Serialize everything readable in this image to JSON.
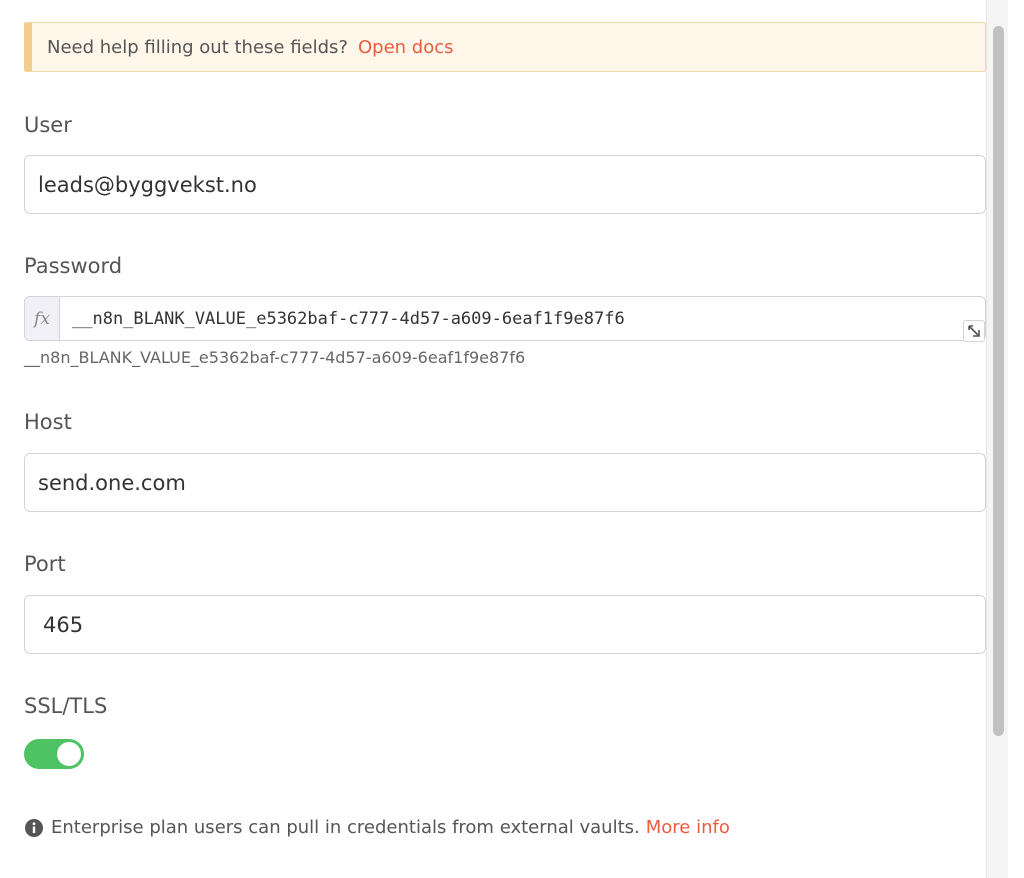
{
  "notice": {
    "text": "Need help filling out these fields?",
    "link": "Open docs"
  },
  "fields": {
    "user": {
      "label": "User",
      "value": "leads@byggvekst.no"
    },
    "password": {
      "label": "Password",
      "fx_label": "fx",
      "value": "__n8n_BLANK_VALUE_e5362baf-c777-4d57-a609-6eaf1f9e87f6",
      "hint": "__n8n_BLANK_VALUE_e5362baf-c777-4d57-a609-6eaf1f9e87f6"
    },
    "host": {
      "label": "Host",
      "value": "send.one.com"
    },
    "port": {
      "label": "Port",
      "value": "465"
    },
    "ssl": {
      "label": "SSL/TLS",
      "enabled": true
    }
  },
  "footer": {
    "text": "Enterprise plan users can pull in credentials from external vaults.",
    "link": "More info"
  },
  "colors": {
    "accent": "#ea5c3e",
    "toggle_on": "#4fc263",
    "notice_bg": "#fef7ea"
  },
  "icons": {
    "expand": "expand-icon",
    "info": "info-icon"
  }
}
